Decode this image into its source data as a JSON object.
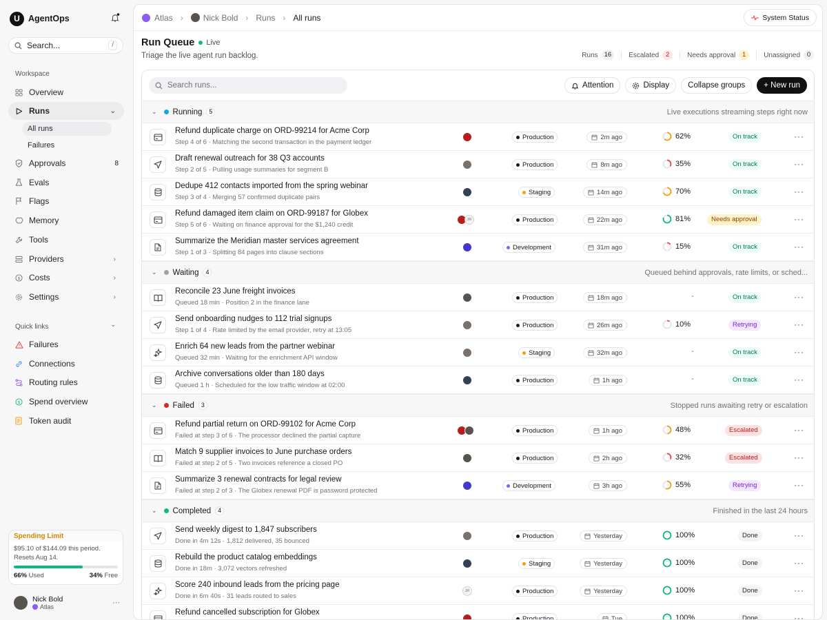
{
  "app": {
    "name": "AgentOps",
    "logo_letter": "U"
  },
  "search": {
    "label": "Search...",
    "shortcut": "/"
  },
  "sidebar": {
    "workspace_label": "Workspace",
    "items": [
      {
        "label": "Overview",
        "icon": "grid-icon"
      },
      {
        "label": "Runs",
        "icon": "play-icon"
      },
      {
        "label": "Approvals",
        "icon": "shield-check-icon",
        "badge": "8"
      },
      {
        "label": "Evals",
        "icon": "flask-icon"
      },
      {
        "label": "Flags",
        "icon": "flag-icon"
      },
      {
        "label": "Memory",
        "icon": "brain-icon"
      },
      {
        "label": "Tools",
        "icon": "wrench-icon"
      },
      {
        "label": "Providers",
        "icon": "server-icon"
      },
      {
        "label": "Costs",
        "icon": "dollar-icon"
      },
      {
        "label": "Settings",
        "icon": "gear-icon"
      }
    ],
    "runs_subitems": [
      "All runs",
      "Failures"
    ],
    "quick_links_label": "Quick links",
    "quick_links": [
      {
        "label": "Failures",
        "icon": "warning-icon",
        "color": "#ef4444"
      },
      {
        "label": "Connections",
        "icon": "link-icon",
        "color": "#3b82f6"
      },
      {
        "label": "Routing rules",
        "icon": "route-icon",
        "color": "#8b5cf6"
      },
      {
        "label": "Spend overview",
        "icon": "dollar-icon",
        "color": "#10b981"
      },
      {
        "label": "Token audit",
        "icon": "document-icon",
        "color": "#f59e0b"
      }
    ]
  },
  "spending": {
    "title": "Spending Limit",
    "line1": "$95.10 of $144.09 this period.",
    "line2": "Resets Aug 14.",
    "used_pct": "66%",
    "used_label": "Used",
    "free_pct": "34%",
    "free_label": "Free",
    "fill_fraction": 0.66
  },
  "user": {
    "name": "Nick Bold",
    "workspace": "Atlas"
  },
  "breadcrumb": [
    "Atlas",
    "Nick Bold",
    "Runs",
    "All runs"
  ],
  "system_status": "System Status",
  "page": {
    "title": "Run Queue",
    "live": "Live",
    "subtitle": "Triage the live agent run backlog.",
    "stats": [
      {
        "label": "Runs",
        "count": "16",
        "tone": "neutral"
      },
      {
        "label": "Escalated",
        "count": "2",
        "tone": "red"
      },
      {
        "label": "Needs approval",
        "count": "1",
        "tone": "amber"
      },
      {
        "label": "Unassigned",
        "count": "0",
        "tone": "neutral"
      }
    ]
  },
  "toolbar": {
    "search_placeholder": "Search runs...",
    "attention": "Attention",
    "display": "Display",
    "collapse": "Collapse groups",
    "new_run": "+ New run"
  },
  "colors": {
    "running": "#0ea5e9",
    "waiting": "#a1a1aa",
    "failed": "#dc2626",
    "completed": "#10b981",
    "production": "#18181b",
    "staging": "#f59e0b",
    "development": "#8b5cf6"
  },
  "groups": [
    {
      "name": "Running",
      "count": "5",
      "dot": "running",
      "desc": "Live executions streaming steps right now",
      "rows": [
        {
          "icon": "card-icon",
          "title": "Refund duplicate charge on ORD-99214 for Acme Corp",
          "sub": "Step 4 of 6 · Matching the second transaction in the payment ledger",
          "avatars": [
            "#b91c1c"
          ],
          "env": "Production",
          "env_color": "production",
          "time": "2m ago",
          "progress": "62%",
          "progress_value": 0.62,
          "progress_color": "#f59e0b",
          "status": "On track",
          "status_class": "st-ok"
        },
        {
          "icon": "send-icon",
          "title": "Draft renewal outreach for 38 Q3 accounts",
          "sub": "Step 2 of 5 · Pulling usage summaries for segment B",
          "avatars": [
            "#78716c"
          ],
          "env": "Production",
          "env_color": "production",
          "time": "8m ago",
          "progress": "35%",
          "progress_value": 0.35,
          "progress_color": "#ef4444",
          "status": "On track",
          "status_class": "st-ok"
        },
        {
          "icon": "database-icon",
          "title": "Dedupe 412 contacts imported from the spring webinar",
          "sub": "Step 3 of 4 · Merging 57 confirmed duplicate pairs",
          "avatars": [
            "#334155"
          ],
          "env": "Staging",
          "env_color": "staging",
          "time": "14m ago",
          "progress": "70%",
          "progress_value": 0.7,
          "progress_color": "#f59e0b",
          "status": "On track",
          "status_class": "st-ok"
        },
        {
          "icon": "card-icon",
          "title": "Refund damaged item claim on ORD-99187 for Globex",
          "sub": "Step 5 of 6 · Waiting on finance approval for the $1,240 credit",
          "avatars": [
            "#b91c1c",
            "JR"
          ],
          "env": "Production",
          "env_color": "production",
          "time": "22m ago",
          "progress": "81%",
          "progress_value": 0.81,
          "progress_color": "#10b981",
          "status": "Needs approval",
          "status_class": "st-appr"
        },
        {
          "icon": "file-icon",
          "title": "Summarize the Meridian master services agreement",
          "sub": "Step 1 of 3 · Splitting 84 pages into clause sections",
          "avatars": [
            "#4338ca"
          ],
          "env": "Development",
          "env_color": "development",
          "time": "31m ago",
          "progress": "15%",
          "progress_value": 0.15,
          "progress_color": "#ef4444",
          "status": "On track",
          "status_class": "st-ok"
        }
      ]
    },
    {
      "name": "Waiting",
      "count": "4",
      "dot": "waiting",
      "desc": "Queued behind approvals, rate limits, or sched...",
      "rows": [
        {
          "icon": "book-icon",
          "title": "Reconcile 23 June freight invoices",
          "sub": "Queued 18 min · Position 2 in the finance lane",
          "avatars": [
            "#57534e"
          ],
          "env": "Production",
          "env_color": "production",
          "time": "18m ago",
          "progress": "-",
          "progress_value": null,
          "status": "On track",
          "status_class": "st-ok"
        },
        {
          "icon": "send-icon",
          "title": "Send onboarding nudges to 112 trial signups",
          "sub": "Step 1 of 4 · Rate limited by the email provider, retry at 13:05",
          "avatars": [
            "#78716c"
          ],
          "env": "Production",
          "env_color": "production",
          "time": "26m ago",
          "progress": "10%",
          "progress_value": 0.1,
          "progress_color": "#ef4444",
          "status": "Retrying",
          "status_class": "st-retry"
        },
        {
          "icon": "sparkle-icon",
          "title": "Enrich 64 new leads from the partner webinar",
          "sub": "Queued 32 min · Waiting for the enrichment API window",
          "avatars": [
            "#78716c"
          ],
          "env": "Staging",
          "env_color": "staging",
          "time": "32m ago",
          "progress": "-",
          "progress_value": null,
          "status": "On track",
          "status_class": "st-ok"
        },
        {
          "icon": "database-icon",
          "title": "Archive conversations older than 180 days",
          "sub": "Queued 1 h · Scheduled for the low traffic window at 02:00",
          "avatars": [
            "#334155"
          ],
          "env": "Production",
          "env_color": "production",
          "time": "1h ago",
          "progress": "-",
          "progress_value": null,
          "status": "On track",
          "status_class": "st-ok"
        }
      ]
    },
    {
      "name": "Failed",
      "count": "3",
      "dot": "failed",
      "desc": "Stopped runs awaiting retry or escalation",
      "rows": [
        {
          "icon": "card-icon",
          "title": "Refund partial return on ORD-99102 for Acme Corp",
          "sub": "Failed at step 3 of 6 · The processor declined the partial capture",
          "avatars": [
            "#b91c1c",
            "#57534e"
          ],
          "env": "Production",
          "env_color": "production",
          "time": "1h ago",
          "progress": "48%",
          "progress_value": 0.48,
          "progress_color": "#f59e0b",
          "status": "Escalated",
          "status_class": "st-esc"
        },
        {
          "icon": "book-icon",
          "title": "Match 9 supplier invoices to June purchase orders",
          "sub": "Failed at step 2 of 5 · Two invoices reference a closed PO",
          "avatars": [
            "#57534e"
          ],
          "env": "Production",
          "env_color": "production",
          "time": "2h ago",
          "progress": "32%",
          "progress_value": 0.32,
          "progress_color": "#ef4444",
          "status": "Escalated",
          "status_class": "st-esc"
        },
        {
          "icon": "file-icon",
          "title": "Summarize 3 renewal contracts for legal review",
          "sub": "Failed at step 2 of 3 · The Globex renewal PDF is password protected",
          "avatars": [
            "#4338ca"
          ],
          "env": "Development",
          "env_color": "development",
          "time": "3h ago",
          "progress": "55%",
          "progress_value": 0.55,
          "progress_color": "#f59e0b",
          "status": "Retrying",
          "status_class": "st-retry"
        }
      ]
    },
    {
      "name": "Completed",
      "count": "4",
      "dot": "completed",
      "desc": "Finished in the last 24 hours",
      "rows": [
        {
          "icon": "send-icon",
          "title": "Send weekly digest to 1,847 subscribers",
          "sub": "Done in 4m 12s · 1,812 delivered, 35 bounced",
          "avatars": [
            "#78716c"
          ],
          "env": "Production",
          "env_color": "production",
          "time": "Yesterday",
          "progress": "100%",
          "progress_value": 1.0,
          "progress_color": "#10b981",
          "status": "Done",
          "status_class": "st-done"
        },
        {
          "icon": "database-icon",
          "title": "Rebuild the product catalog embeddings",
          "sub": "Done in 18m · 3,072 vectors refreshed",
          "avatars": [
            "#334155"
          ],
          "env": "Staging",
          "env_color": "staging",
          "time": "Yesterday",
          "progress": "100%",
          "progress_value": 1.0,
          "progress_color": "#10b981",
          "status": "Done",
          "status_class": "st-done"
        },
        {
          "icon": "sparkle-icon",
          "title": "Score 240 inbound leads from the pricing page",
          "sub": "Done in 6m 40s · 31 leads routed to sales",
          "avatars": [
            "JR"
          ],
          "env": "Production",
          "env_color": "production",
          "time": "Yesterday",
          "progress": "100%",
          "progress_value": 1.0,
          "progress_color": "#10b981",
          "status": "Done",
          "status_class": "st-done"
        },
        {
          "icon": "card-icon",
          "title": "Refund cancelled subscription for Globex",
          "sub": "",
          "avatars": [
            "#b91c1c"
          ],
          "env": "Production",
          "env_color": "production",
          "time": "Tue",
          "progress": "100%",
          "progress_value": 1.0,
          "progress_color": "#10b981",
          "status": "Done",
          "status_class": "st-done"
        }
      ]
    }
  ]
}
